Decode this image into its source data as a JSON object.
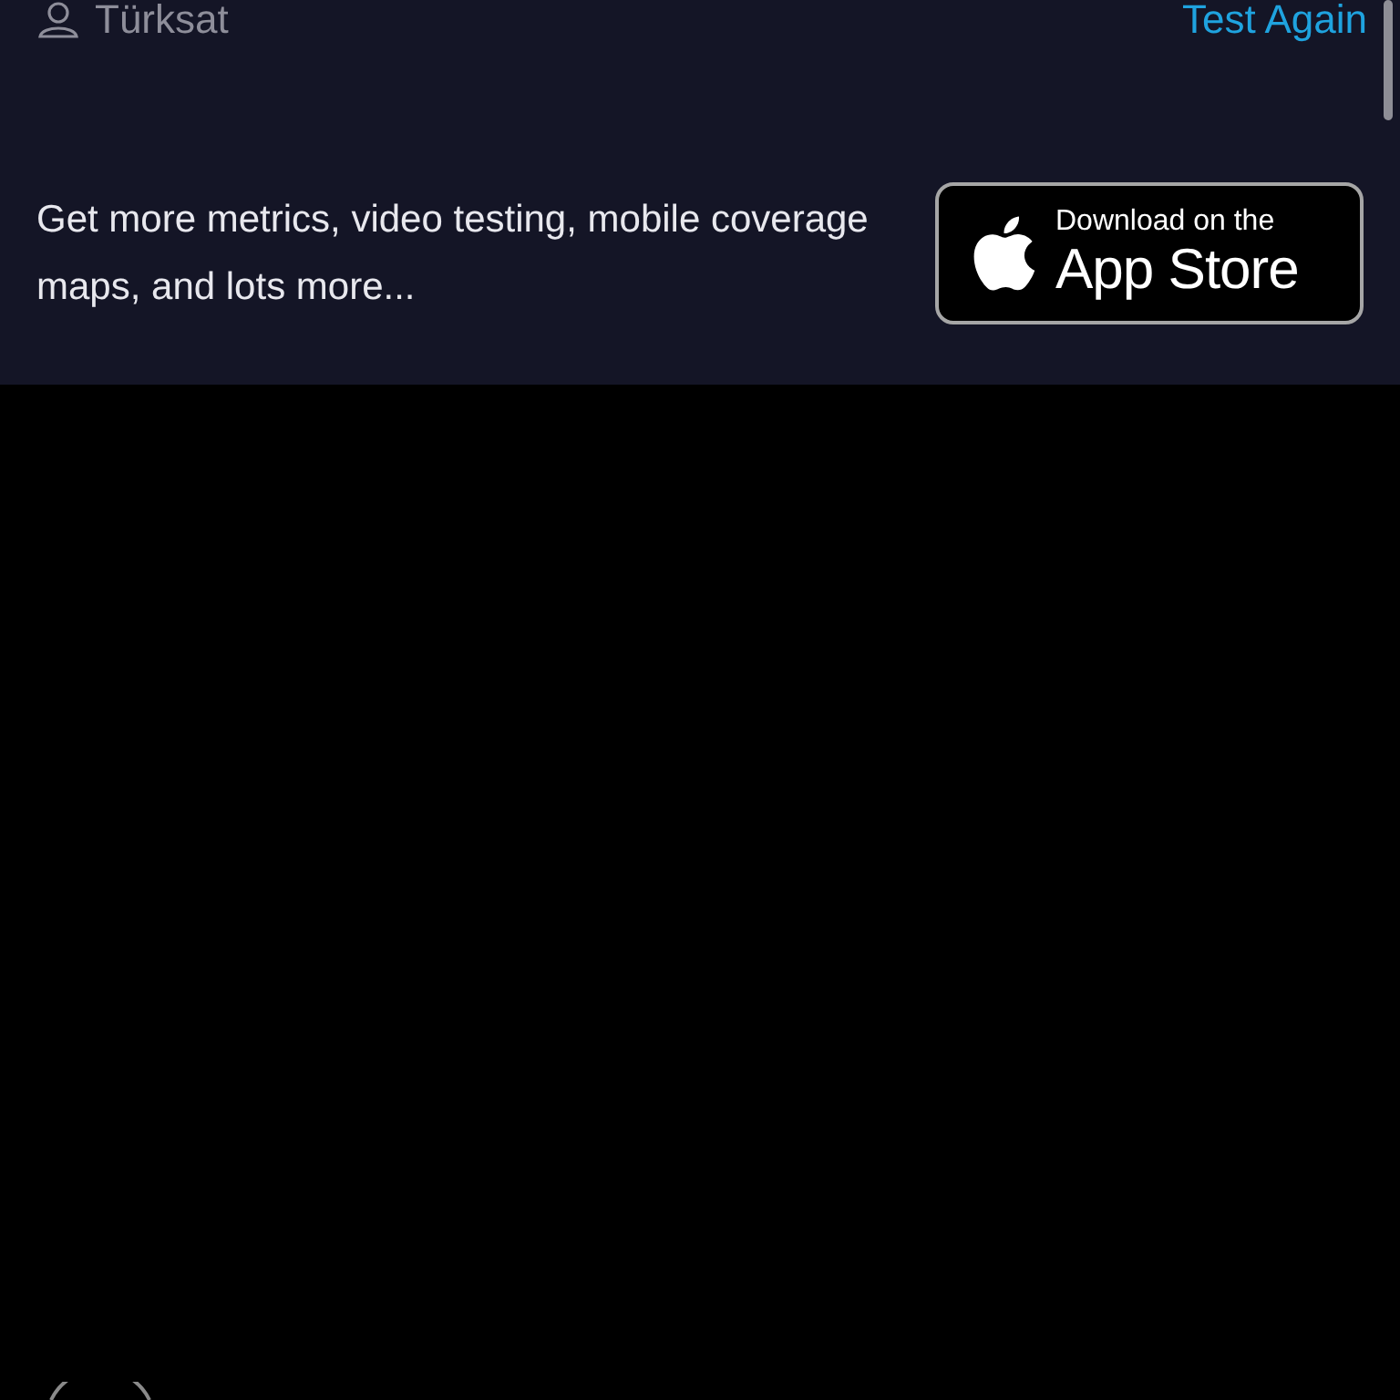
{
  "result_header": {
    "provider": "Türksat",
    "action": "Test Again"
  },
  "promo": {
    "text": "Get more metrics, video testing, mobile coverage maps, and lots more...",
    "badge_small": "Download on the",
    "badge_large": "App Store"
  }
}
